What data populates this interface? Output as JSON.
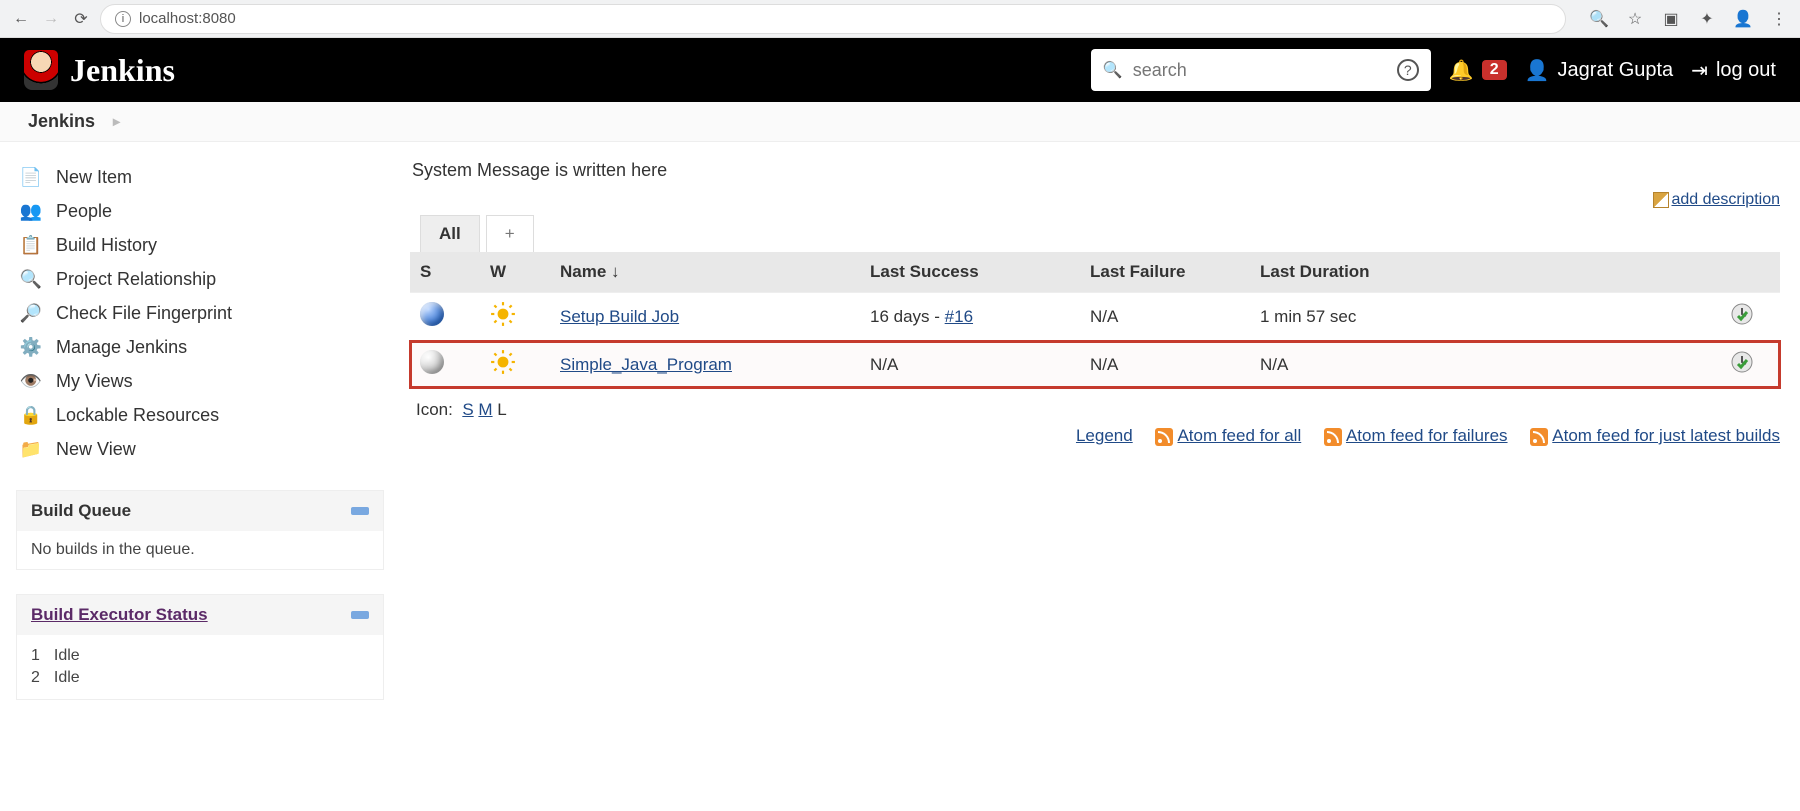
{
  "browser": {
    "url": "localhost:8080"
  },
  "header": {
    "brand": "Jenkins",
    "search_placeholder": "search",
    "notif_count": "2",
    "user_name": "Jagrat Gupta",
    "logout": "log out"
  },
  "breadcrumb": {
    "root": "Jenkins"
  },
  "sidebar": {
    "items": [
      {
        "label": "New Item",
        "icon": "new-item-icon"
      },
      {
        "label": "People",
        "icon": "people-icon"
      },
      {
        "label": "Build History",
        "icon": "build-history-icon"
      },
      {
        "label": "Project Relationship",
        "icon": "project-relationship-icon"
      },
      {
        "label": "Check File Fingerprint",
        "icon": "fingerprint-icon"
      },
      {
        "label": "Manage Jenkins",
        "icon": "gear-icon"
      },
      {
        "label": "My Views",
        "icon": "my-views-icon"
      },
      {
        "label": "Lockable Resources",
        "icon": "lockable-resources-icon"
      },
      {
        "label": "New View",
        "icon": "new-view-icon"
      }
    ],
    "build_queue": {
      "title": "Build Queue",
      "empty_text": "No builds in the queue."
    },
    "executor": {
      "title": "Build Executor Status",
      "rows": [
        {
          "num": "1",
          "state": "Idle"
        },
        {
          "num": "2",
          "state": "Idle"
        }
      ]
    }
  },
  "main": {
    "system_message": "System Message is written here",
    "add_description": "add description",
    "tabs": {
      "all": "All",
      "plus": "+"
    },
    "columns": {
      "status": "S",
      "weather": "W",
      "name": "Name  ↓",
      "last_success": "Last Success",
      "last_failure": "Last Failure",
      "last_duration": "Last Duration"
    },
    "jobs": [
      {
        "status": "blue",
        "name": "Setup Build Job",
        "last_success_text": "16 days - ",
        "last_success_build": "#16",
        "last_failure": "N/A",
        "last_duration": "1 min 57 sec",
        "highlight": false
      },
      {
        "status": "grey",
        "name": "Simple_Java_Program",
        "last_success_text": "N/A",
        "last_success_build": "",
        "last_failure": "N/A",
        "last_duration": "N/A",
        "highlight": true
      }
    ],
    "icon_legend": {
      "label": "Icon:",
      "s": "S",
      "m": "M",
      "l": "L"
    },
    "feeds": {
      "legend": "Legend",
      "atom_all": "Atom feed for all",
      "atom_failures": "Atom feed for failures",
      "atom_latest": "Atom feed for just latest builds"
    }
  }
}
